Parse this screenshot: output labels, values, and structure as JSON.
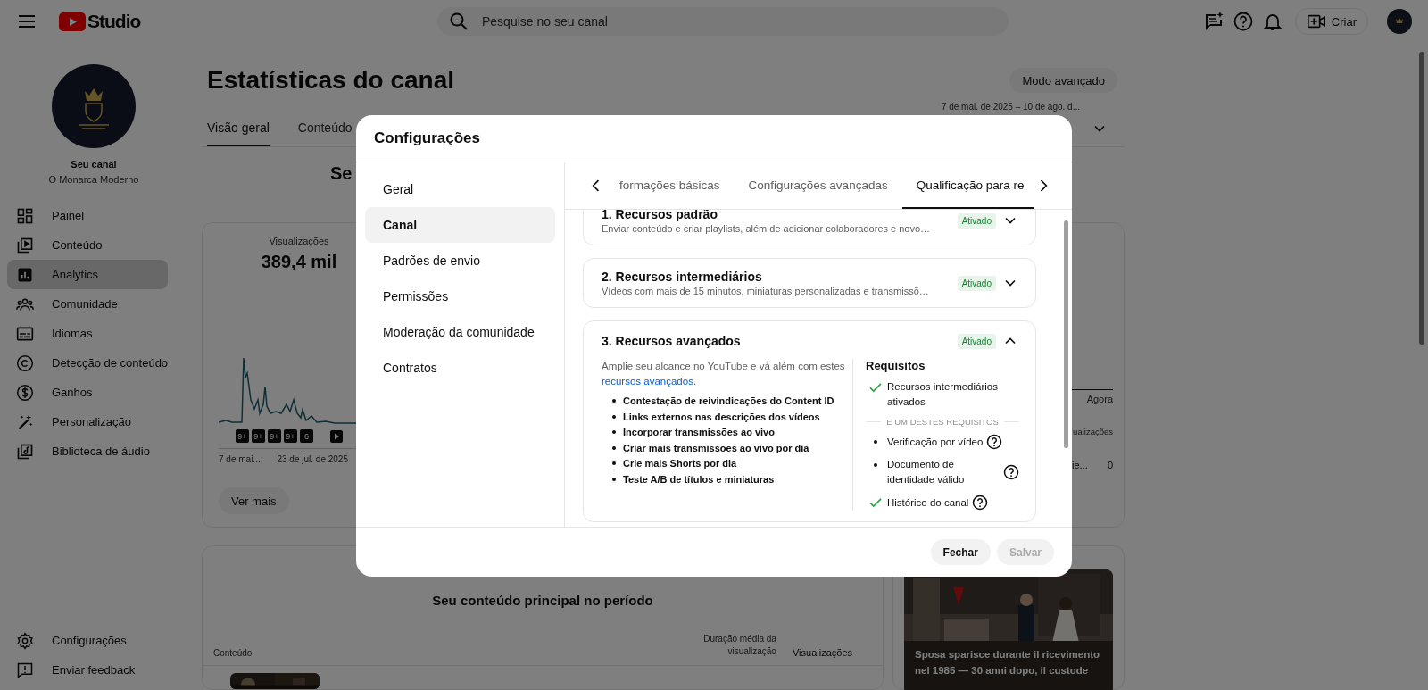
{
  "topbar": {
    "logo_text": "Studio",
    "search": {
      "placeholder": "Pesquise no seu canal"
    },
    "create_button": "Criar"
  },
  "sidebar": {
    "channel_label": "Seu canal",
    "channel_name": "O Monarca Moderno",
    "items": [
      {
        "label": "Painel",
        "selected": false
      },
      {
        "label": "Conteúdo",
        "selected": false
      },
      {
        "label": "Analytics",
        "selected": true
      },
      {
        "label": "Comunidade",
        "selected": false
      },
      {
        "label": "Idiomas",
        "selected": false
      },
      {
        "label": "Detecção de conteúdo",
        "selected": false
      },
      {
        "label": "Ganhos",
        "selected": false
      },
      {
        "label": "Personalização",
        "selected": false
      },
      {
        "label": "Biblioteca de áudio",
        "selected": false
      }
    ],
    "footer_items": [
      "Configurações",
      "Enviar feedback"
    ]
  },
  "page": {
    "title": "Estatísticas do canal",
    "advanced_button": "Modo avançado",
    "tabs": [
      {
        "label": "Visão geral",
        "selected": true
      },
      {
        "label": "Conteúdo",
        "selected": false
      }
    ],
    "date_range": "7 de mai. de 2025 – 10 de ago. d...",
    "summary_heading": "Se",
    "metric": {
      "label": "Visualizações",
      "value": "389,4 mil"
    },
    "chart_markers": [
      "9+",
      "9+",
      "9+",
      "9+",
      "6"
    ],
    "chart_dates": [
      "7 de mai....",
      "23 de jul. de 2025"
    ],
    "see_more_button": "Ver mais",
    "side_column": {
      "header": "Agora",
      "column_label": "ualizações",
      "row_label": "ie...",
      "row_value": "0"
    },
    "top_content": {
      "title": "Seu conteúdo principal no período",
      "columns": [
        "Conteúdo",
        "Duração média da visualização",
        "Visualizações"
      ]
    },
    "video_card": {
      "title": "Sposa sparisce durante il ricevimento nel 1985 — 30 anni dopo, il custode"
    }
  },
  "settings_dialog": {
    "title": "Configurações",
    "nav": [
      {
        "label": "Geral",
        "selected": false
      },
      {
        "label": "Canal",
        "selected": true
      },
      {
        "label": "Padrões de envio",
        "selected": false
      },
      {
        "label": "Permissões",
        "selected": false
      },
      {
        "label": "Moderação da comunidade",
        "selected": false
      },
      {
        "label": "Contratos",
        "selected": false
      }
    ],
    "tabs": [
      {
        "label": "formações básicas",
        "selected": false
      },
      {
        "label": "Configurações avançadas",
        "selected": false
      },
      {
        "label": "Qualificação para re",
        "selected": true
      }
    ],
    "sections": [
      {
        "title": "1. Recursos padrão",
        "description": "Enviar conteúdo e criar playlists, além de adicionar colaboradores e novo…",
        "status": "Ativado",
        "expanded": false
      },
      {
        "title": "2. Recursos intermediários",
        "description": "Vídeos com mais de 15 minutos, miniaturas personalizadas e transmissõ…",
        "status": "Ativado",
        "expanded": false
      },
      {
        "title": "3. Recursos avançados",
        "status": "Ativado",
        "expanded": true,
        "intro": "Amplie seu alcance no YouTube e vá além com estes",
        "intro_link": "recursos avançados",
        "intro_end": ".",
        "features": [
          "Contestação de reivindicações do Content ID",
          "Links externos nas descrições dos vídeos",
          "Incorporar transmissões ao vivo",
          "Criar mais transmissões ao vivo por dia",
          "Crie mais Shorts por dia",
          "Teste A/B de títulos e miniaturas"
        ],
        "requirements_title": "Requisitos",
        "requirements": [
          {
            "kind": "check",
            "label": "Recursos intermediários ativados",
            "help": false
          },
          {
            "kind": "divider",
            "label": "E UM DESTES REQUISITOS"
          },
          {
            "kind": "bullet",
            "label": "Verificação por vídeo",
            "help": true
          },
          {
            "kind": "bullet",
            "label": "Documento de identidade válido",
            "help": true
          },
          {
            "kind": "check",
            "label": "Histórico do canal",
            "help": true
          }
        ]
      }
    ],
    "buttons": [
      {
        "label": "Fechar",
        "disabled": false
      },
      {
        "label": "Salvar",
        "disabled": true
      }
    ]
  }
}
